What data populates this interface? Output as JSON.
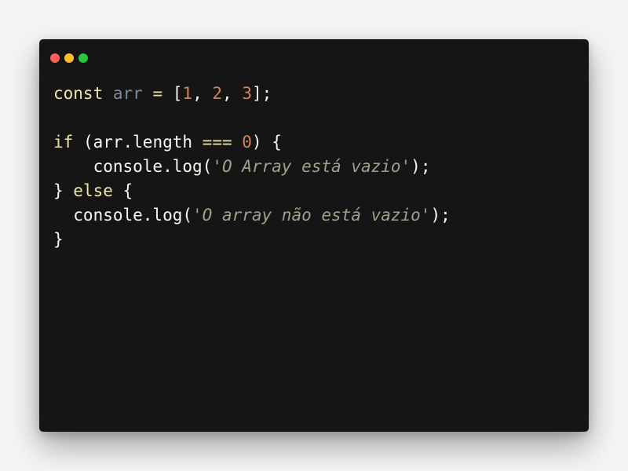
{
  "window": {
    "controls": {
      "close_color": "#ff5f57",
      "minimize_color": "#febc2e",
      "maximize_color": "#28c840"
    }
  },
  "code": {
    "lines": [
      [
        {
          "t": "const",
          "k": "kw"
        },
        {
          "t": " ",
          "k": "plain"
        },
        {
          "t": "arr",
          "k": "var"
        },
        {
          "t": " ",
          "k": "plain"
        },
        {
          "t": "=",
          "k": "op"
        },
        {
          "t": " [",
          "k": "plain"
        },
        {
          "t": "1",
          "k": "num"
        },
        {
          "t": ", ",
          "k": "plain"
        },
        {
          "t": "2",
          "k": "num"
        },
        {
          "t": ", ",
          "k": "plain"
        },
        {
          "t": "3",
          "k": "num"
        },
        {
          "t": "];",
          "k": "plain"
        }
      ],
      [],
      [
        {
          "t": "if",
          "k": "kw"
        },
        {
          "t": " (arr.length ",
          "k": "plain"
        },
        {
          "t": "===",
          "k": "op"
        },
        {
          "t": " ",
          "k": "plain"
        },
        {
          "t": "0",
          "k": "num"
        },
        {
          "t": ") {",
          "k": "plain"
        }
      ],
      [
        {
          "t": "    console.log(",
          "k": "plain"
        },
        {
          "t": "'O Array está vazio'",
          "k": "str"
        },
        {
          "t": ");",
          "k": "plain"
        }
      ],
      [
        {
          "t": "} ",
          "k": "plain"
        },
        {
          "t": "else",
          "k": "kw"
        },
        {
          "t": " {",
          "k": "plain"
        }
      ],
      [
        {
          "t": "  console.log(",
          "k": "plain"
        },
        {
          "t": "'O array não está vazio'",
          "k": "str"
        },
        {
          "t": ");",
          "k": "plain"
        }
      ],
      [
        {
          "t": "}",
          "k": "plain"
        }
      ]
    ]
  }
}
